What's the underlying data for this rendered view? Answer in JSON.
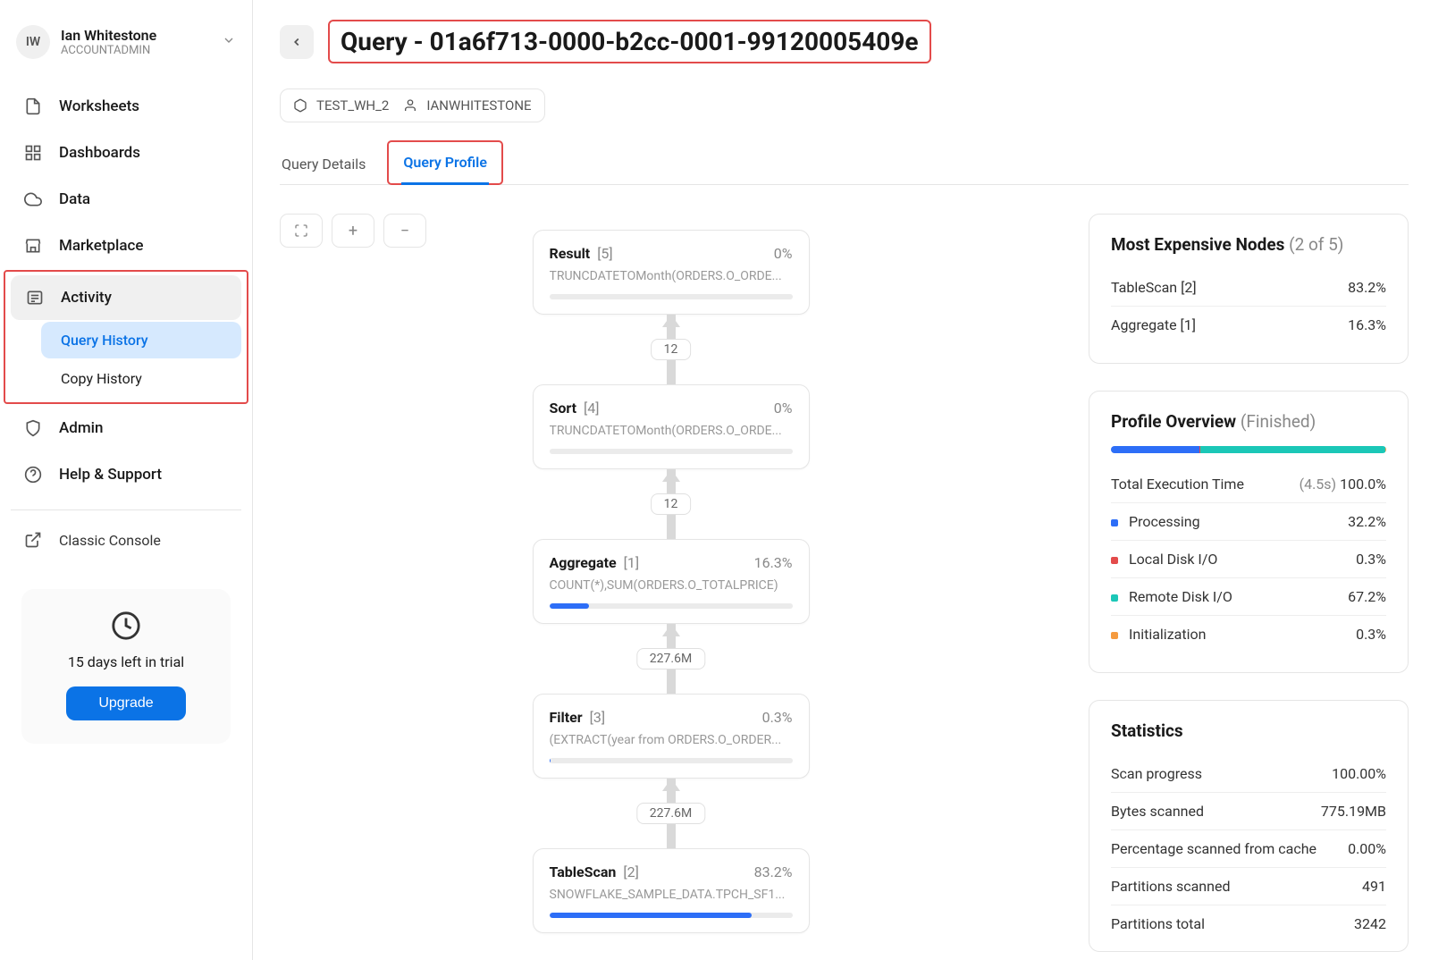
{
  "user": {
    "initials": "IW",
    "name": "Ian Whitestone",
    "role": "ACCOUNTADMIN"
  },
  "nav": {
    "worksheets": "Worksheets",
    "dashboards": "Dashboards",
    "data": "Data",
    "marketplace": "Marketplace",
    "activity": "Activity",
    "query_history": "Query History",
    "copy_history": "Copy History",
    "admin": "Admin",
    "help": "Help & Support",
    "classic": "Classic Console"
  },
  "trial": {
    "text": "15 days left in trial",
    "button": "Upgrade"
  },
  "header": {
    "title": "Query - 01a6f713-0000-b2cc-0001-99120005409e",
    "warehouse": "TEST_WH_2",
    "user_run": "IANWHITESTONE"
  },
  "tabs": {
    "details": "Query Details",
    "profile": "Query Profile"
  },
  "plan": [
    {
      "name": "Result",
      "id": "[5]",
      "pct": "0%",
      "sub": "TRUNCDATETOMonth(ORDERS.O_ORDE...",
      "fill": 0,
      "edge": "12"
    },
    {
      "name": "Sort",
      "id": "[4]",
      "pct": "0%",
      "sub": "TRUNCDATETOMonth(ORDERS.O_ORDE...",
      "fill": 0,
      "edge": "12"
    },
    {
      "name": "Aggregate",
      "id": "[1]",
      "pct": "16.3%",
      "sub": "COUNT(*),SUM(ORDERS.O_TOTALPRICE)",
      "fill": 16.3,
      "edge": "227.6M"
    },
    {
      "name": "Filter",
      "id": "[3]",
      "pct": "0.3%",
      "sub": "(EXTRACT(year from ORDERS.O_ORDER...",
      "fill": 0.3,
      "edge": "227.6M"
    },
    {
      "name": "TableScan",
      "id": "[2]",
      "pct": "83.2%",
      "sub": "SNOWFLAKE_SAMPLE_DATA.TPCH_SF1...",
      "fill": 83.2,
      "edge": null
    }
  ],
  "expensive": {
    "title": "Most Expensive Nodes",
    "count": "(2 of 5)",
    "rows": [
      {
        "label": "TableScan [2]",
        "val": "83.2%"
      },
      {
        "label": "Aggregate [1]",
        "val": "16.3%"
      }
    ]
  },
  "overview": {
    "title": "Profile Overview",
    "status": "(Finished)",
    "total_label": "Total Execution Time",
    "total_time": "(4.5s)",
    "total_pct": "100.0%",
    "segments": [
      {
        "label": "Processing",
        "val": "32.2%",
        "color": "#2d6ef7",
        "width": 32.2
      },
      {
        "label": "Local Disk I/O",
        "val": "0.3%",
        "color": "#e34b4b",
        "width": 0.3
      },
      {
        "label": "Remote Disk I/O",
        "val": "67.2%",
        "color": "#1bc7b7",
        "width": 67.2
      },
      {
        "label": "Initialization",
        "val": "0.3%",
        "color": "#f59a3e",
        "width": 0.3
      }
    ]
  },
  "stats": {
    "title": "Statistics",
    "rows": [
      {
        "label": "Scan progress",
        "val": "100.00%"
      },
      {
        "label": "Bytes scanned",
        "val": "775.19MB"
      },
      {
        "label": "Percentage scanned from cache",
        "val": "0.00%"
      },
      {
        "label": "Partitions scanned",
        "val": "491"
      },
      {
        "label": "Partitions total",
        "val": "3242"
      }
    ]
  }
}
